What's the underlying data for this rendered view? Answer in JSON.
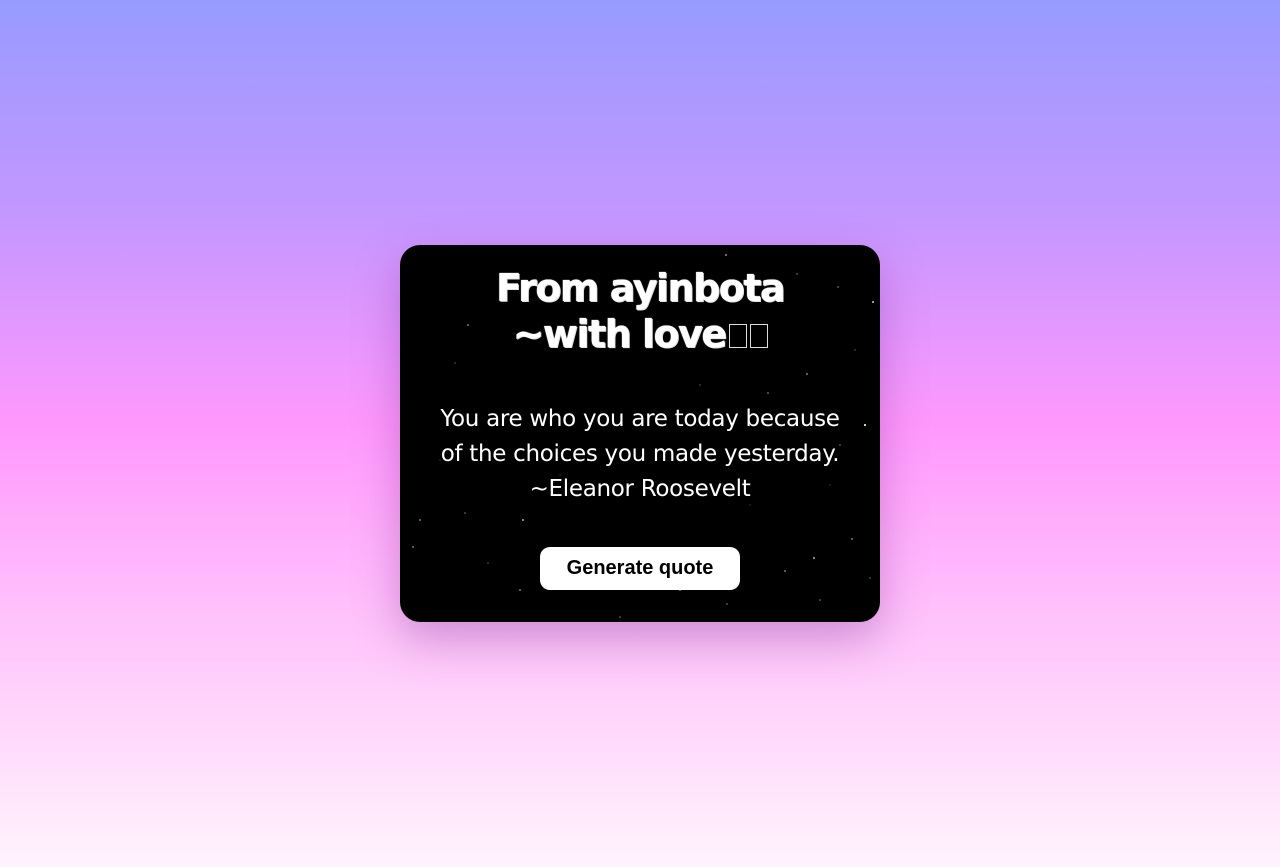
{
  "card": {
    "title_line1": "From ayinbota",
    "title_line2": "~with love",
    "quote_line1": "You are who you are today because",
    "quote_line2": "of the choices you made yesterday.",
    "author": "~Eleanor Roosevelt",
    "button_label": "Generate quote"
  },
  "colors": {
    "card_background": "#000000",
    "button_background": "#ffffff",
    "gradient_top": "#979bff",
    "gradient_middle": "#ff98fd",
    "gradient_bottom": "#fff3fd"
  }
}
